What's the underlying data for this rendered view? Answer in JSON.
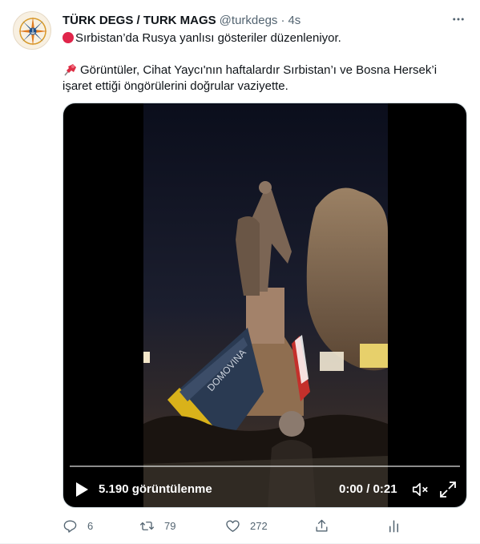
{
  "tweet": {
    "author_name": "TÜRK DEGS / TURK MAGS",
    "author_handle": "@turkdegs",
    "separator": "·",
    "time": "4s",
    "text_line1": "Sırbistan’da Rusya yanlısı gösteriler düzenleniyor.",
    "text_line2": "Görüntüler, Cihat Yaycı'nın haftalardır Sırbistan’ı ve Bosna Hersek’i",
    "text_line3": "işaret ettiği öngörülerini doğrular vaziyette.",
    "icons": {
      "line1": "red-circle-emoji",
      "line2": "pushpin-emoji",
      "more": "more-options-icon"
    }
  },
  "video": {
    "views": "5.190 görüntülenme",
    "timecode": "0:00 / 0:21",
    "progress": 0.0,
    "controls": [
      "play-icon",
      "mute-icon",
      "fullscreen-icon"
    ]
  },
  "actions": {
    "replies": "6",
    "retweets": "79",
    "likes": "272",
    "icons": [
      "reply-icon",
      "retweet-icon",
      "like-icon",
      "share-icon",
      "analytics-icon"
    ]
  },
  "colors": {
    "text": "#0f1419",
    "secondary": "#536471",
    "emoji_red": "#e0254a"
  }
}
